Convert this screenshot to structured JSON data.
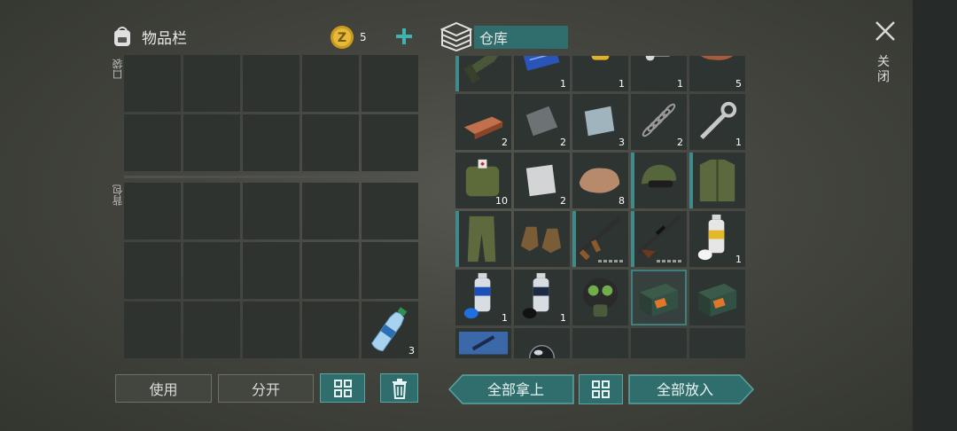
{
  "inventory": {
    "title": "物品栏",
    "coin_count": "5",
    "pocket_label": "口袋",
    "backpack_label": "背包",
    "water_count": "3"
  },
  "warehouse": {
    "title": "仓库",
    "cells": [
      {
        "icon": "rifle-icon",
        "count": "",
        "bar": true
      },
      {
        "icon": "circuit-board-icon",
        "count": "1",
        "bar": false
      },
      {
        "icon": "oil-filter-icon",
        "count": "1",
        "bar": false
      },
      {
        "icon": "engine-part-icon",
        "count": "1",
        "bar": false
      },
      {
        "icon": "ore-icon",
        "count": "5",
        "bar": false
      },
      {
        "icon": "copper-ingot-icon",
        "count": "2",
        "bar": false
      },
      {
        "icon": "iron-plate-icon",
        "count": "2",
        "bar": false
      },
      {
        "icon": "steel-plate-icon",
        "count": "3",
        "bar": false
      },
      {
        "icon": "spring-icon",
        "count": "2",
        "bar": false
      },
      {
        "icon": "wrench-icon",
        "count": "1",
        "bar": false
      },
      {
        "icon": "medkit-bag-icon",
        "count": "10",
        "bar": false
      },
      {
        "icon": "aluminum-plate-icon",
        "count": "2",
        "bar": false
      },
      {
        "icon": "stone-icon",
        "count": "8",
        "bar": false
      },
      {
        "icon": "camo-cap-icon",
        "count": "",
        "bar": true
      },
      {
        "icon": "camo-vest-icon",
        "count": "",
        "bar": true
      },
      {
        "icon": "camo-pants-icon",
        "count": "",
        "bar": true
      },
      {
        "icon": "boots-icon",
        "count": "",
        "bar": false
      },
      {
        "icon": "assault-rifle-icon",
        "count": "",
        "bar": true,
        "durability": true
      },
      {
        "icon": "sniper-rifle-icon",
        "count": "",
        "bar": true,
        "durability": true
      },
      {
        "icon": "spray-can-white-icon",
        "count": "1",
        "bar": false
      },
      {
        "icon": "spray-can-blue-icon",
        "count": "1",
        "bar": false
      },
      {
        "icon": "spray-can-black-icon",
        "count": "1",
        "bar": false
      },
      {
        "icon": "gas-mask-icon",
        "count": "",
        "bar": false
      },
      {
        "icon": "explosive-box-icon",
        "count": "",
        "bar": false,
        "selected": true
      },
      {
        "icon": "explosive-box-icon",
        "count": "",
        "bar": false
      },
      {
        "icon": "blue-fabric-icon",
        "count": "",
        "bar": false
      },
      {
        "icon": "glass-lens-icon",
        "count": "",
        "bar": false
      },
      {
        "icon": "",
        "count": "",
        "bar": false
      },
      {
        "icon": "",
        "count": "",
        "bar": false
      },
      {
        "icon": "",
        "count": "",
        "bar": false
      }
    ]
  },
  "buttons": {
    "use": "使用",
    "split": "分开",
    "take_all": "全部拿上",
    "put_all": "全部放入"
  },
  "close_label": "关闭"
}
